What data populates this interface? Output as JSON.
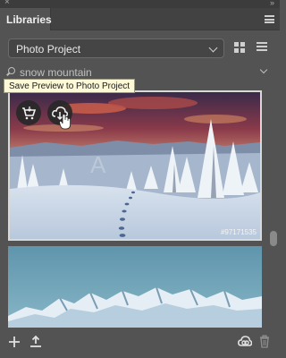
{
  "window": {
    "close_glyph": "×",
    "collapse_glyph": "»"
  },
  "tabs": [
    {
      "label": "Libraries",
      "active": true
    }
  ],
  "library_select": {
    "value": "Photo Project"
  },
  "view_toggle": {
    "grid_icon": "grid-view-icon",
    "list_icon": "list-view-icon"
  },
  "search": {
    "value": "snow mountain",
    "icon": "search-icon"
  },
  "tooltip": {
    "text": "Save Preview to Photo Project"
  },
  "results": [
    {
      "type": "image",
      "subject": "snowy forest at sunset",
      "badge": "#97171535",
      "actions": [
        "cart-icon",
        "cloud-download-icon"
      ],
      "selected": true
    },
    {
      "type": "image",
      "subject": "snow mountain range",
      "selected": false
    }
  ],
  "bottom_bar": {
    "icons": [
      "add-icon",
      "upload-icon",
      "creative-cloud-icon",
      "trash-icon"
    ]
  },
  "colors": {
    "panel_bg": "#535353",
    "tab_bar_bg": "#424242",
    "tooltip_bg": "#fdf9d6"
  }
}
